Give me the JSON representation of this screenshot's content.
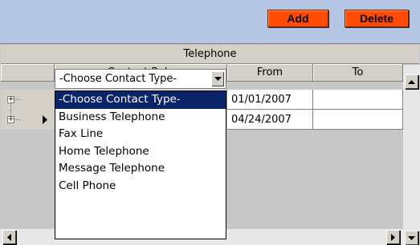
{
  "toolbar": {
    "add_label": "Add",
    "delete_label": "Delete"
  },
  "grid": {
    "caption": "Telephone",
    "columns": [
      "Contact Role",
      "From",
      "To"
    ],
    "rows": [
      {
        "role": "Business Telephone",
        "from": "01/01/2007",
        "to": ""
      },
      {
        "role": "-Choose Contact Type-",
        "from": "04/24/2007",
        "to": ""
      }
    ]
  },
  "dropdown": {
    "selected": "-Choose Contact Type-",
    "options": [
      "-Choose Contact Type-",
      "Business Telephone",
      "Fax Line",
      "Home Telephone",
      "Message Telephone",
      "Cell Phone"
    ]
  },
  "colors": {
    "button": "#ff4b05",
    "background": "#b4c6e4",
    "selection": "#0a246a"
  },
  "icons": {
    "expand": "plus-box-icon",
    "row_pointer": "triangle-right-icon",
    "dropdown": "triangle-down-icon"
  }
}
